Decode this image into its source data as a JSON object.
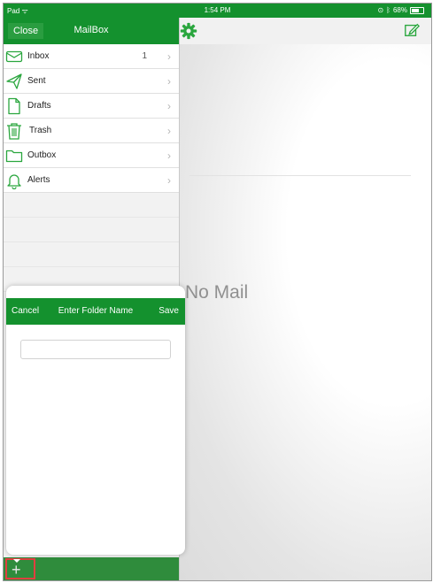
{
  "status_bar": {
    "device": "Pad",
    "time": "1:54 PM",
    "battery": "68%",
    "battery_level": 0.68
  },
  "sidebar": {
    "close_label": "Close",
    "title": "MailBox",
    "folders": [
      {
        "label": "Inbox",
        "count": "1",
        "icon": "envelope-icon"
      },
      {
        "label": "Sent",
        "count": "",
        "icon": "paper-plane-icon"
      },
      {
        "label": "Drafts",
        "count": "",
        "icon": "document-icon"
      },
      {
        "label": "Trash",
        "count": "",
        "icon": "trash-icon"
      },
      {
        "label": "Outbox",
        "count": "",
        "icon": "folder-icon"
      },
      {
        "label": "Alerts",
        "count": "",
        "icon": "bell-icon"
      }
    ],
    "add_button": "+"
  },
  "detail": {
    "empty_text": "No Mail"
  },
  "popup": {
    "cancel_label": "Cancel",
    "title": "Enter Folder Name",
    "save_label": "Save",
    "folder_name_value": "",
    "folder_name_placeholder": ""
  },
  "colors": {
    "brand_green": "#14912e",
    "highlight_red": "#e04040"
  }
}
